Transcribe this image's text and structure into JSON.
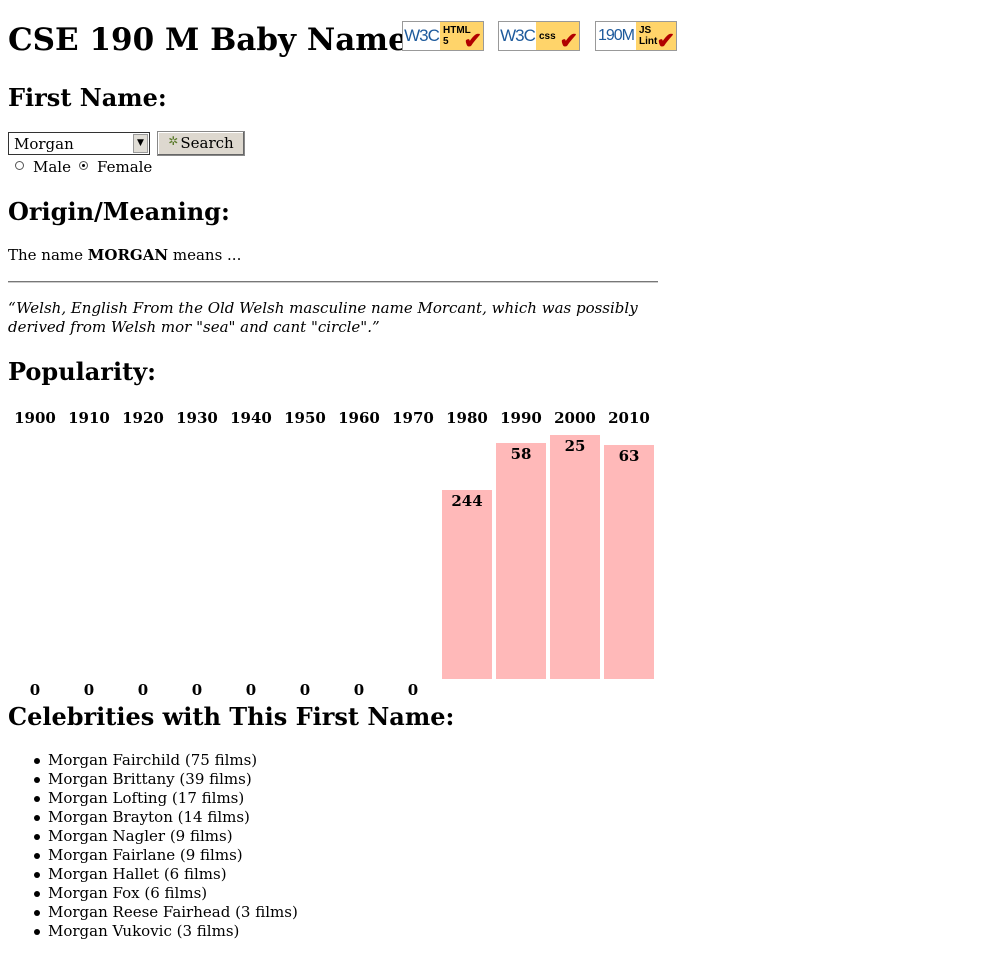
{
  "header": {
    "title": "CSE 190 M Baby Names"
  },
  "badges": [
    {
      "left": "W3C",
      "right": "HTML\n5"
    },
    {
      "left": "W3C",
      "right": "css"
    },
    {
      "left": "190M",
      "right": "JS\nLint"
    }
  ],
  "first_name": {
    "heading": "First Name:",
    "selected": "Morgan",
    "search_label": "Search",
    "gender": {
      "male_label": "Male",
      "female_label": "Female",
      "selected": "Female"
    }
  },
  "meaning": {
    "heading": "Origin/Meaning:",
    "prefix": "The name ",
    "name": "MORGAN",
    "suffix": " means ...",
    "quote": "“Welsh, English From the Old Welsh masculine name Morcant, which was possibly derived from Welsh mor \"sea\" and cant \"circle\".”"
  },
  "popularity": {
    "heading": "Popularity:"
  },
  "chart_data": {
    "type": "bar",
    "categories": [
      "1900",
      "1910",
      "1920",
      "1930",
      "1940",
      "1950",
      "1960",
      "1970",
      "1980",
      "1990",
      "2000",
      "2010"
    ],
    "values": [
      0,
      0,
      0,
      0,
      0,
      0,
      0,
      0,
      244,
      58,
      25,
      63
    ],
    "title": "",
    "xlabel": "",
    "ylabel": "",
    "note": "rank values; 0 = unranked, lower rank = taller bar"
  },
  "celebrities": {
    "heading": "Celebrities with This First Name:",
    "items": [
      "Morgan Fairchild (75 films)",
      "Morgan Brittany (39 films)",
      "Morgan Lofting (17 films)",
      "Morgan Brayton (14 films)",
      "Morgan Nagler (9 films)",
      "Morgan Fairlane (9 films)",
      "Morgan Hallet (6 films)",
      "Morgan Fox (6 films)",
      "Morgan Reese Fairhead (3 films)",
      "Morgan Vukovic (3 films)"
    ]
  },
  "colors": {
    "bar": "#ffb9b9",
    "badge_bg": "#ffd46a",
    "check": "#b10000"
  }
}
